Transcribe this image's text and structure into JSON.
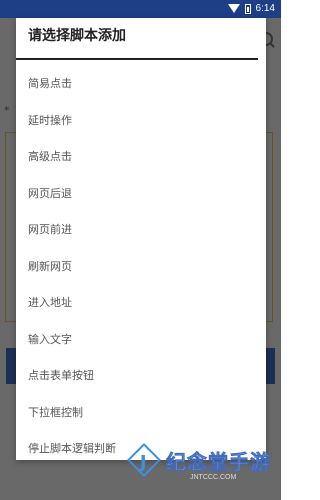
{
  "status_bar": {
    "time": "6:14"
  },
  "background": {
    "star_label": "*"
  },
  "dialog": {
    "title": "请选择脚本添加",
    "options": [
      "简易点击",
      "延时操作",
      "高级点击",
      "网页后退",
      "网页前进",
      "刷新网页",
      "进入地址",
      "输入文字",
      "点击表单按钮",
      "下拉框控制",
      "停止脚本逻辑判断"
    ]
  },
  "watermark": {
    "brand": "纪念堂手游",
    "domain": "JNTCCC.COM"
  }
}
